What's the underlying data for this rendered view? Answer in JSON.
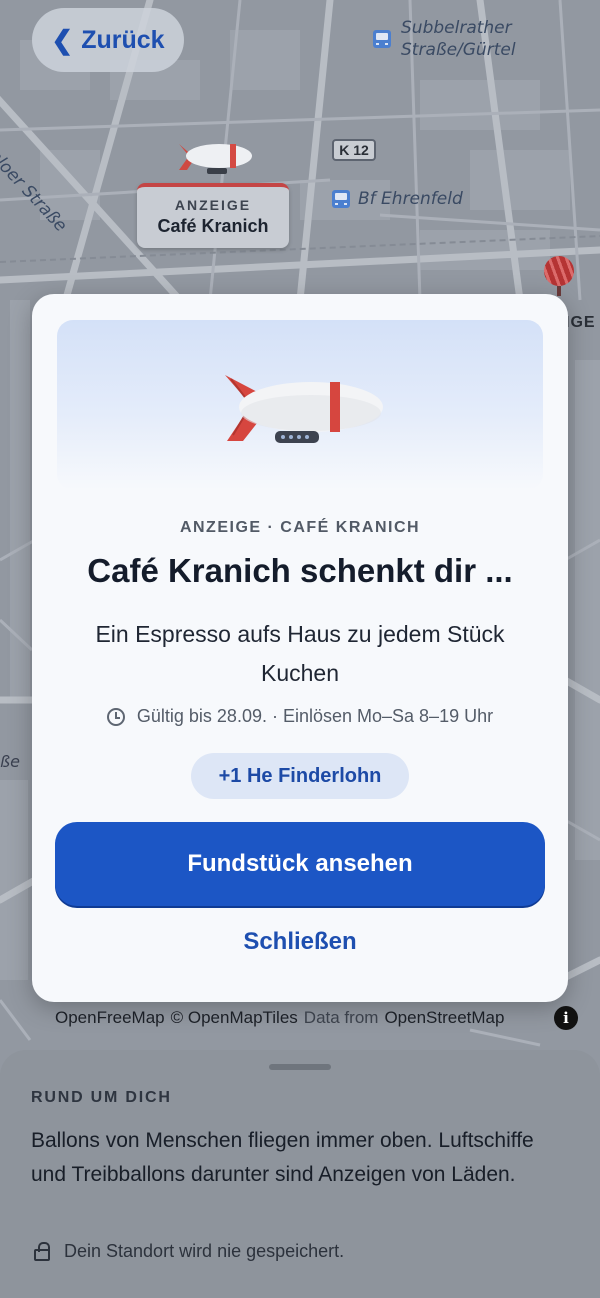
{
  "nav": {
    "back_label": "Zurück",
    "back_icon": "chevron-left-icon"
  },
  "map": {
    "labels": {
      "stop_subbelrather_line1": "Subbelrather",
      "stop_subbelrather_line2": "Straße/Gürtel",
      "road_shield": "K 12",
      "stop_ehrenfeld": "Bf Ehrenfeld",
      "street_venloer": "enloer Straße",
      "edge_fragment_right": "IGE",
      "edge_fragment_left": "ße"
    },
    "ad_pin": {
      "kicker": "ANZEIGE",
      "name": "Café Kranich"
    },
    "attribution": {
      "openfreemap": "OpenFreeMap",
      "openmaptiles": "© OpenMapTiles",
      "data_from": "Data from",
      "osm": "OpenStreetMap",
      "info_icon": "i"
    }
  },
  "modal": {
    "illustration": "airship-icon",
    "eyebrow": "ANZEIGE · CAFÉ KRANICH",
    "title": "Café Kranich schenkt dir ...",
    "subtitle": "Ein Espresso aufs Haus zu jedem Stück Kuchen",
    "validity": "Gültig bis 28.09. · Einlösen Mo–Sa 8–19 Uhr",
    "reward_badge": "+1 He Finderlohn",
    "primary_button": "Fundstück ansehen",
    "close_button": "Schließen"
  },
  "sheet": {
    "heading": "RUND UM DICH",
    "body": "Ballons von Menschen fliegen immer oben. Luftschiffe und Treibballons darunter sind Anzeigen von Läden.",
    "privacy_note": "Dein Standort wird nie gespeichert."
  },
  "colors": {
    "accent": "#1c56c5",
    "accent_text": "#1e4fb0",
    "airship_stripe": "#d64a43",
    "modal_bg": "#f7f9fc"
  }
}
